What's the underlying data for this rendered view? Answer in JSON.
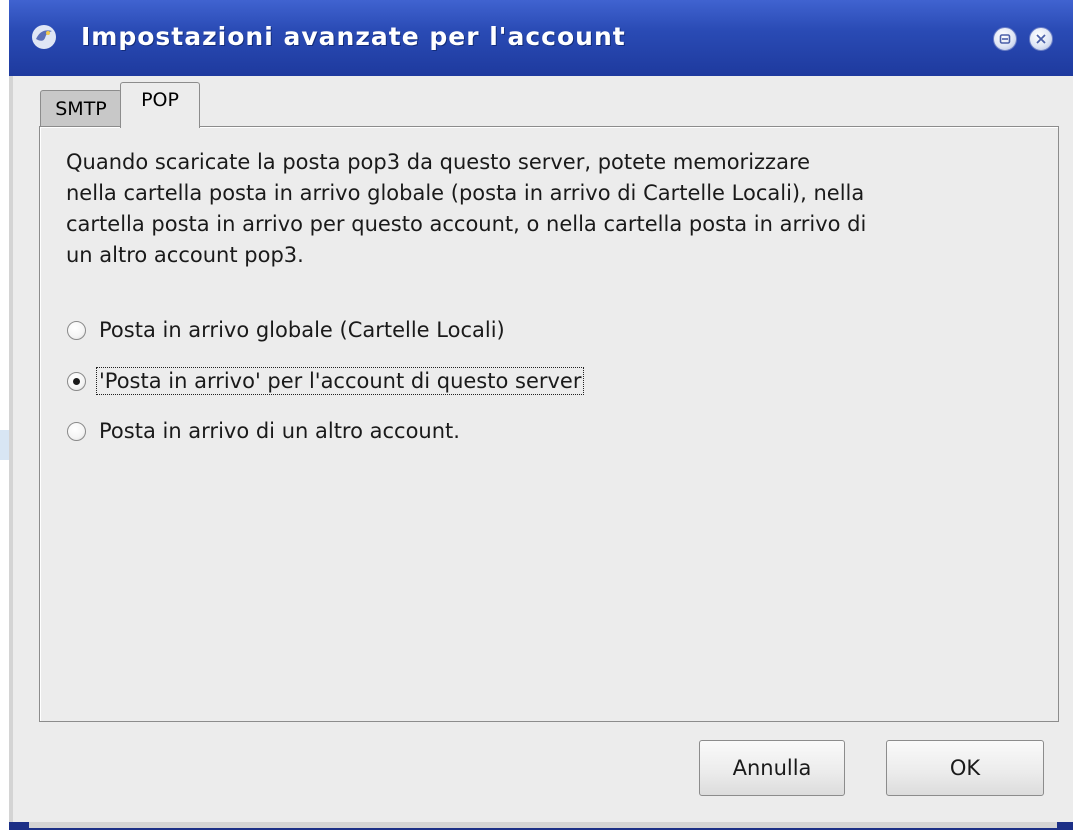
{
  "window": {
    "title": "Impostazioni avanzate per l'account",
    "icon": "thunderbird-icon",
    "controls": [
      "minimize-icon",
      "close-icon"
    ]
  },
  "tabs": [
    {
      "label": "SMTP",
      "selected": false
    },
    {
      "label": "POP",
      "selected": true
    }
  ],
  "pop": {
    "description_lines": [
      "Quando scaricate la posta pop3 da questo server, potete memorizzare",
      "nella cartella posta in arrivo globale (posta in arrivo di Cartelle Locali), nella",
      "cartella posta in arrivo per questo account, o nella cartella posta in arrivo di",
      "un altro account pop3."
    ],
    "options": [
      {
        "label": "Posta in arrivo globale (Cartelle Locali)",
        "checked": false
      },
      {
        "label": "'Posta in arrivo' per l'account di questo server",
        "checked": true
      },
      {
        "label": "Posta in arrivo di un altro account.",
        "checked": false
      }
    ]
  },
  "buttons": {
    "cancel": "Annulla",
    "ok": "OK"
  },
  "colors": {
    "titlebar": "#2a4bb5",
    "client_bg": "#ececec"
  }
}
